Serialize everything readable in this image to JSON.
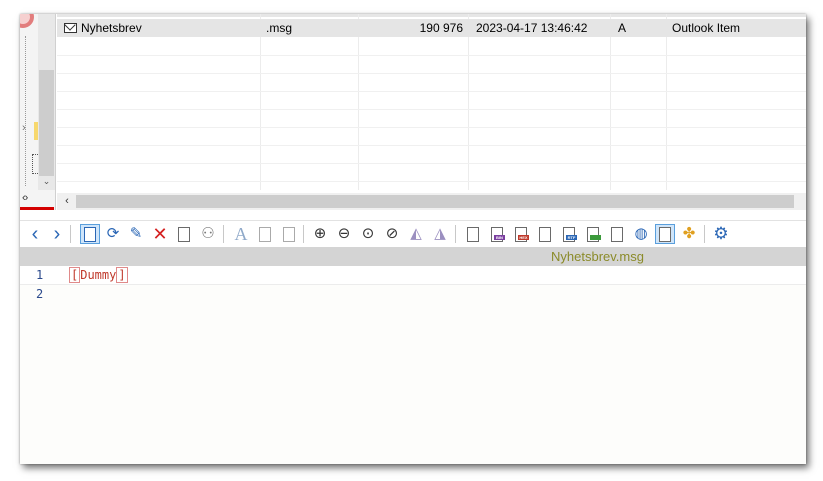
{
  "file_list": {
    "rows": [
      {
        "name": "Nyhetsbrev",
        "extension": ".msg",
        "size": "190 976",
        "modified": "2023-04-17 13:46:42",
        "attributes": "A",
        "type": "Outlook Item"
      }
    ]
  },
  "toolbar": {
    "icons": [
      "back-icon",
      "forward-icon",
      "edit-mode-icon",
      "refresh-icon",
      "pencil-icon",
      "delete-icon",
      "properties-icon",
      "binoculars-icon",
      "font-icon",
      "page-icon",
      "page-numbered-icon",
      "zoom-in-icon",
      "zoom-out-icon",
      "zoom-fit-icon",
      "zoom-reset-icon",
      "rotate-left-icon",
      "rotate-right-icon",
      "text-view-icon",
      "bin-view-icon",
      "hex-view-icon",
      "unicode-view-icon",
      "rtf-view-icon",
      "image-view-icon",
      "multimedia-view-icon",
      "web-view-icon",
      "document-view-icon",
      "plugin-icon",
      "settings-icon"
    ],
    "accent_color": "#2a66b5",
    "delete_color": "#d42020"
  },
  "viewer": {
    "title": "Nyhetsbrev.msg",
    "lines": [
      {
        "number": "1",
        "text": "Dummy"
      },
      {
        "number": "2",
        "text": ""
      }
    ],
    "title_color": "#8b8b2a",
    "code_color": "#c0392b"
  }
}
